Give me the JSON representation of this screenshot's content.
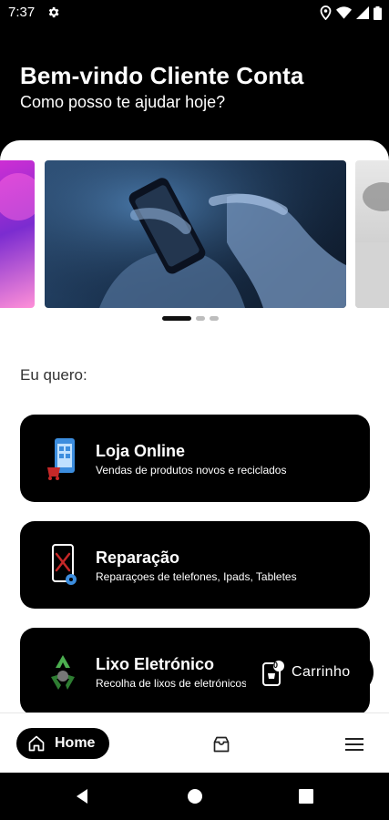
{
  "status_bar": {
    "time": "7:37",
    "icons": [
      "gear-icon",
      "location-icon",
      "wifi-icon",
      "signal-icon",
      "battery-icon"
    ]
  },
  "header": {
    "title": "Bem-vindo Cliente Conta",
    "subtitle": "Como posso te ajudar hoje?"
  },
  "carousel": {
    "slides": [
      "pink-lights-image",
      "phone-in-hands-image",
      "gray-room-image"
    ],
    "active_index": 0,
    "dot_count": 3
  },
  "section": {
    "label": "Eu quero:"
  },
  "options": [
    {
      "title": "Loja Online",
      "subtitle": "Vendas de produtos novos e reciclados",
      "icon": "phone-shop-icon"
    },
    {
      "title": "Reparação",
      "subtitle": "Reparaçoes de telefones, Ipads, Tabletes",
      "icon": "phone-repair-icon"
    },
    {
      "title": "Lixo Eletrónico",
      "subtitle": "Recolha de lixos de eletrónicos",
      "icon": "recycle-icon"
    }
  ],
  "cart_fab": {
    "label": "Carrinho",
    "count": "0"
  },
  "bottom_nav": {
    "home_label": "Home",
    "items": [
      "home-icon",
      "cart-icon",
      "menu-icon"
    ]
  },
  "colors": {
    "background": "#000000",
    "surface": "#ffffff",
    "accent_blue": "#3c8dde",
    "repair_red": "#c62828"
  }
}
